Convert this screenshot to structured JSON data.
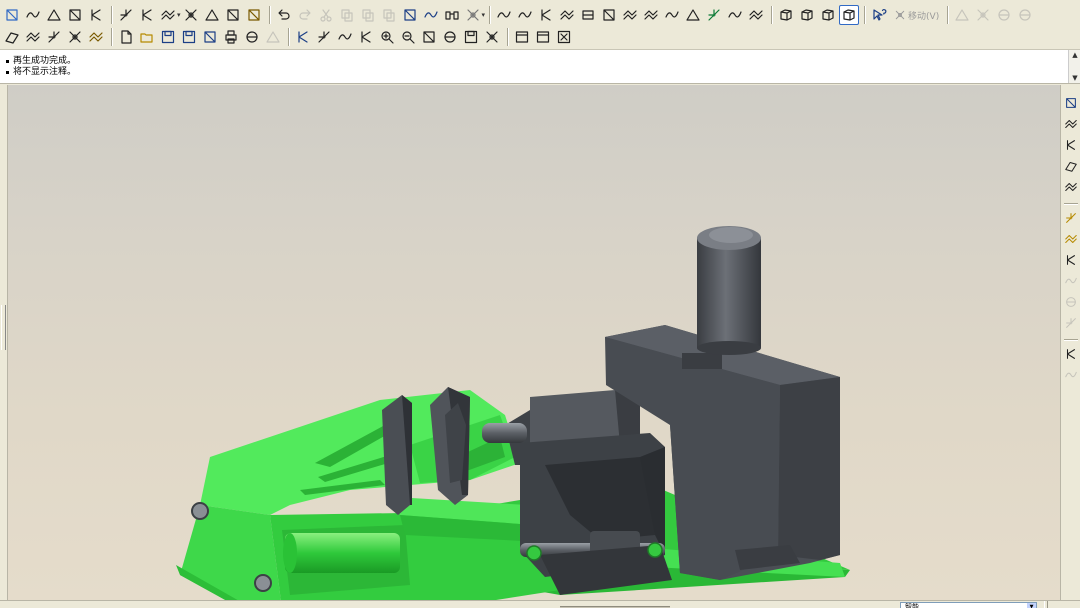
{
  "toolbar": {
    "row1": [
      {
        "name": "datum-plane-icon",
        "color": "#316ac5"
      },
      {
        "name": "datum-axis-group-icon",
        "color": "#222"
      },
      {
        "name": "sketch-plane-icon",
        "color": "#222"
      },
      {
        "name": "sketch-offset-icon",
        "color": "#222"
      },
      {
        "name": "sketch-line-icon",
        "color": "#222"
      },
      "sep",
      {
        "name": "datum-point-icon",
        "color": "#222"
      },
      {
        "name": "datum-curve-icon",
        "color": "#222"
      },
      {
        "name": "datum-csys-icon",
        "color": "#222",
        "dropdown": true
      },
      {
        "name": "datum-cross-icon",
        "color": "#222"
      },
      {
        "name": "intersect-icon",
        "color": "#222"
      },
      {
        "name": "split-icon",
        "color": "#222"
      },
      {
        "name": "analysis-icon",
        "color": "#7a5a00"
      },
      "sep",
      {
        "name": "undo-icon",
        "color": "#222"
      },
      {
        "name": "redo-icon",
        "color": "#999"
      },
      {
        "name": "cut-icon",
        "color": "#999"
      },
      {
        "name": "copy-icon",
        "color": "#999"
      },
      {
        "name": "paste-icon",
        "color": "#999"
      },
      {
        "name": "paste-special-icon",
        "color": "#999"
      },
      {
        "name": "regenerate-icon",
        "color": "#1c3f86"
      },
      {
        "name": "regen-manager-icon",
        "color": "#1c3f86"
      },
      {
        "name": "find-icon",
        "color": "#222"
      },
      {
        "name": "select-box-icon",
        "color": "#777",
        "dropdown": true
      },
      "sep",
      {
        "name": "extrude-icon",
        "color": "#222"
      },
      {
        "name": "revolve-icon",
        "color": "#222"
      },
      {
        "name": "draft-icon",
        "color": "#222"
      },
      {
        "name": "pattern-icon",
        "color": "#222"
      },
      {
        "name": "mirror-icon",
        "color": "#222"
      },
      {
        "name": "trim-icon",
        "color": "#222"
      },
      {
        "name": "shell-icon",
        "color": "#222"
      },
      {
        "name": "sweep-icon",
        "color": "#222"
      },
      {
        "name": "blend-icon",
        "color": "#222"
      },
      {
        "name": "surface-icon",
        "color": "#222"
      },
      {
        "name": "appearance-icon",
        "color": "#0b7a36"
      },
      {
        "name": "rib-icon",
        "color": "#222"
      },
      {
        "name": "measure-icon",
        "color": "#222"
      },
      "sep",
      {
        "name": "wireframe-icon",
        "color": "#222"
      },
      {
        "name": "hidden-line-icon",
        "color": "#222"
      },
      {
        "name": "no-hidden-icon",
        "color": "#222"
      },
      {
        "name": "shading-icon",
        "color": "#222",
        "active": true
      },
      "sep",
      {
        "name": "whats-this-help-icon",
        "color": "#1c3f86"
      },
      {
        "name": "move-label",
        "text": "移动(V)"
      },
      "sep",
      {
        "name": "component-place-icon",
        "color": "#999"
      },
      {
        "name": "assemble-icon",
        "color": "#999"
      },
      {
        "name": "package-icon",
        "color": "#999"
      },
      {
        "name": "component-create-icon",
        "color": "#999"
      }
    ],
    "row2": [
      {
        "name": "constraint-icon",
        "color": "#222"
      },
      {
        "name": "dimension-icon",
        "color": "#222"
      },
      {
        "name": "fillet-icon",
        "color": "#222"
      },
      {
        "name": "chamfer-icon",
        "color": "#222"
      },
      {
        "name": "hole-icon",
        "color": "#7a5a00"
      },
      "sep",
      {
        "name": "new-file-icon",
        "color": "#222"
      },
      {
        "name": "open-file-icon",
        "color": "#b68a00"
      },
      {
        "name": "save-icon",
        "color": "#1c3f86"
      },
      {
        "name": "save-copy-icon",
        "color": "#1c3f86"
      },
      {
        "name": "backup-icon",
        "color": "#1c3f86"
      },
      {
        "name": "print-icon",
        "color": "#222"
      },
      {
        "name": "send-mail-icon",
        "color": "#222"
      },
      {
        "name": "email-link-icon",
        "color": "#999"
      },
      "sep",
      {
        "name": "repaint-icon",
        "color": "#1c3f86"
      },
      {
        "name": "spin-center-icon",
        "color": "#222"
      },
      {
        "name": "orient-icon",
        "color": "#222"
      },
      {
        "name": "pan-icon",
        "color": "#222"
      },
      {
        "name": "zoom-in-icon",
        "color": "#222"
      },
      {
        "name": "zoom-out-icon",
        "color": "#222"
      },
      {
        "name": "refit-icon",
        "color": "#222"
      },
      {
        "name": "reorient-icon",
        "color": "#222"
      },
      {
        "name": "saved-views-icon",
        "color": "#222"
      },
      {
        "name": "layers-icon",
        "color": "#222"
      },
      "sep",
      {
        "name": "window-activate-icon",
        "color": "#222"
      },
      {
        "name": "window-close-icon",
        "color": "#222"
      },
      {
        "name": "window-close-x-icon",
        "color": "#222"
      }
    ]
  },
  "messages": [
    "再生成功完成。",
    "将不显示注释。"
  ],
  "right_toolbar": [
    {
      "name": "datum-display-icon",
      "color": "#1c3f86"
    },
    {
      "name": "axis-display-icon",
      "color": "#222"
    },
    {
      "name": "point-display-icon",
      "color": "#222"
    },
    {
      "name": "csys-display-icon",
      "color": "#222"
    },
    {
      "name": "annotation-display-icon",
      "color": "#222"
    },
    "sep",
    {
      "name": "model-tree-icon",
      "color": "#b68a00"
    },
    {
      "name": "layer-tree-icon",
      "color": "#b68a00"
    },
    {
      "name": "sketch-tool-icon",
      "color": "#222"
    },
    {
      "name": "round-tool-icon",
      "color": "#999"
    },
    {
      "name": "edge-chamfer-icon",
      "color": "#999"
    },
    {
      "name": "draft-tool-icon",
      "color": "#999"
    },
    "sep",
    {
      "name": "family-table-icon",
      "color": "#222"
    },
    {
      "name": "relations-icon",
      "color": "#999"
    }
  ],
  "status": {
    "filter_value": "智能"
  },
  "model": {
    "base_color": "#3de04a",
    "frame_color": "#4b4f55",
    "cylinder_color": "#5a5e64"
  }
}
